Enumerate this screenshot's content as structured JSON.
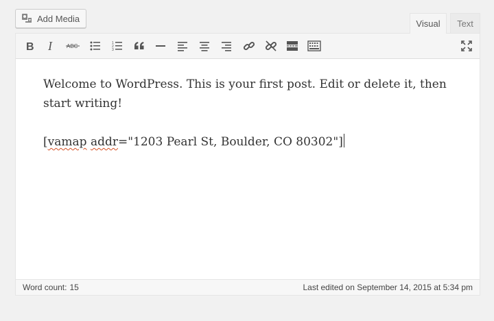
{
  "add_media": {
    "label": "Add Media",
    "icon": "media-camera-icon"
  },
  "tabs": [
    {
      "label": "Visual",
      "active": true
    },
    {
      "label": "Text",
      "active": false
    }
  ],
  "toolbar": {
    "buttons": [
      {
        "name": "bold-icon"
      },
      {
        "name": "italic-icon"
      },
      {
        "name": "strikethrough-icon",
        "label": "ABC"
      },
      {
        "name": "bulleted-list-icon"
      },
      {
        "name": "numbered-list-icon"
      },
      {
        "name": "blockquote-icon"
      },
      {
        "name": "horizontal-rule-icon"
      },
      {
        "name": "align-left-icon"
      },
      {
        "name": "align-center-icon"
      },
      {
        "name": "align-right-icon"
      },
      {
        "name": "insert-link-icon"
      },
      {
        "name": "remove-link-icon"
      },
      {
        "name": "read-more-icon"
      },
      {
        "name": "toolbar-toggle-icon"
      },
      {
        "name": "fullscreen-icon"
      }
    ]
  },
  "content": {
    "paragraph1": "Welcome to WordPress. This is your first post. Edit or delete it, then start writing!",
    "shortcode_open": "[",
    "shortcode_word1": "vamap",
    "shortcode_space": " ",
    "shortcode_word2": "addr",
    "shortcode_rest": "=\"1203 Pearl St, Boulder, CO 80302\"]"
  },
  "status": {
    "word_count_label": "Word count:",
    "word_count_value": "15",
    "last_edited": "Last edited on September 14, 2015 at 5:34 pm"
  },
  "colors": {
    "background": "#f1f1f1",
    "toolbar": "#f5f5f5",
    "icon": "#555555",
    "text": "#333333",
    "spellcheck_underline": "#d54e21"
  }
}
